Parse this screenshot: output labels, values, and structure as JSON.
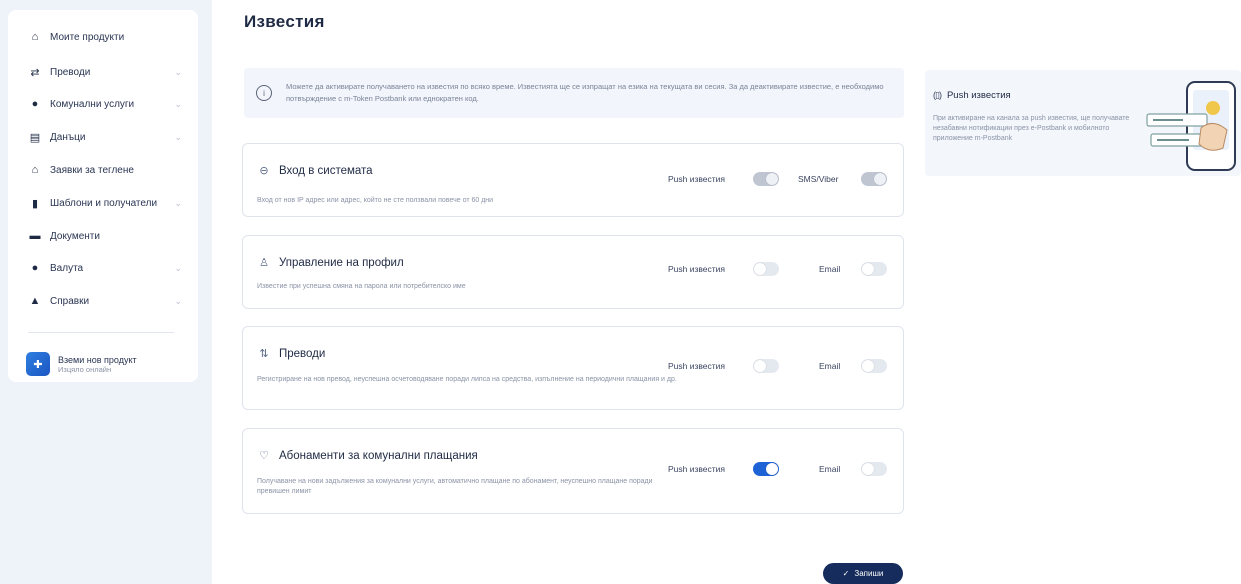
{
  "sidebar": {
    "items": [
      {
        "label": "Моите продукти",
        "icon": "home-icon",
        "glyph": "⌂",
        "has_chevron": false
      },
      {
        "label": "Преводи",
        "icon": "transfer-icon",
        "glyph": "⇄",
        "has_chevron": true
      },
      {
        "label": "Комунални услуги",
        "icon": "bulb-icon",
        "glyph": "●",
        "has_chevron": true
      },
      {
        "label": "Данъци",
        "icon": "document-icon",
        "glyph": "▤",
        "has_chevron": true
      },
      {
        "label": "Заявки за теглене",
        "icon": "bank-icon",
        "glyph": "⌂",
        "has_chevron": false
      },
      {
        "label": "Шаблони и получатели",
        "icon": "clipboard-icon",
        "glyph": "▮",
        "has_chevron": true
      },
      {
        "label": "Документи",
        "icon": "folder-icon",
        "glyph": "▬",
        "has_chevron": false
      },
      {
        "label": "Валута",
        "icon": "currency-icon",
        "glyph": "●",
        "has_chevron": true
      },
      {
        "label": "Справки",
        "icon": "reports-icon",
        "glyph": "▲",
        "has_chevron": true
      }
    ],
    "promo": {
      "title": "Вземи нов продукт",
      "subtitle": "Изцяло онлайн"
    }
  },
  "main": {
    "title": "Известия",
    "info_text": "Можете да активирате получаването на известия по всяко време. Известията ще се изпращат на езика на текущата ви сесия. За да деактивирате известие, е необходимо потвърждение с m-Token Postbank или еднократен код.",
    "cards": [
      {
        "title": "Вход в системата",
        "icon": "lock-icon",
        "glyph": "⊖",
        "description": "Вход от нов IP адрес или адрес, който не сте ползвали повече от 60 дни",
        "toggles": [
          {
            "label": "Push известия",
            "state": "disabled"
          },
          {
            "label": "SMS/Viber",
            "state": "disabled"
          }
        ]
      },
      {
        "title": "Управление на профил",
        "icon": "user-icon",
        "glyph": "♙",
        "description": "Известие при успешна смяна на парола или потребителско име",
        "toggles": [
          {
            "label": "Push известия",
            "state": "off"
          },
          {
            "label": "Email",
            "state": "off"
          }
        ]
      },
      {
        "title": "Преводи",
        "icon": "transfer-arrows-icon",
        "glyph": "⇅",
        "description": "Регистриране на нов превод, неуспешна осчетоводяване поради липса на средства, изпълнение на периодични плащания и др.",
        "toggles": [
          {
            "label": "Push известия",
            "state": "off"
          },
          {
            "label": "Email",
            "state": "off"
          }
        ]
      },
      {
        "title": "Абонаменти за комунални плащания",
        "icon": "bulb-outline-icon",
        "glyph": "♡",
        "description": "Получаване на нови задължения за комунални услуги, автоматично плащане по абонамент, неуспешно плащане поради превишен лимит",
        "toggles": [
          {
            "label": "Push известия",
            "state": "on"
          },
          {
            "label": "Email",
            "state": "off"
          }
        ]
      }
    ],
    "save_label": "Запиши"
  },
  "push_panel": {
    "title": "Push известия",
    "description": "При активиране на канала за push известия, ще получавате незабавни нотификации през e-Postbank и мобилното приложение m-Postbank"
  },
  "colors": {
    "accent": "#1e63d6",
    "dark_button": "#152c5c",
    "sidebar_bg": "#eef2f9",
    "info_bg": "#f2f5fb"
  }
}
